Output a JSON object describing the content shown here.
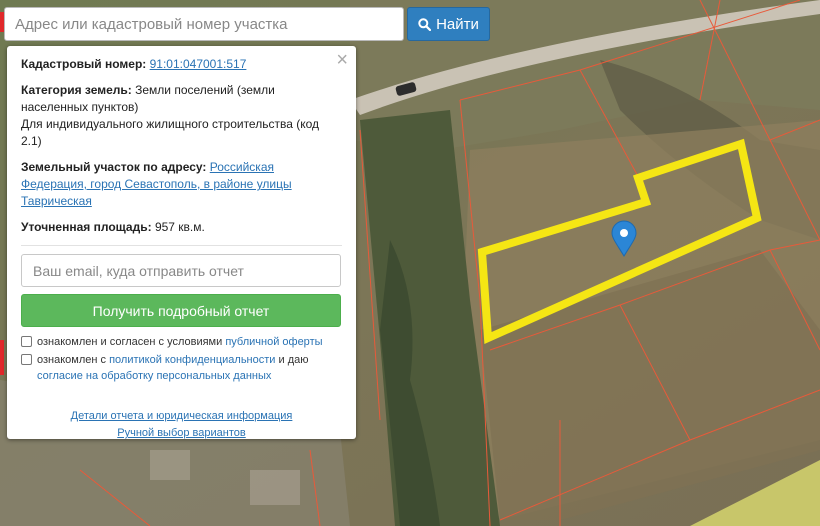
{
  "search": {
    "placeholder": "Адрес или кадастровый номер участка",
    "button_label": "Найти",
    "button_icon": "search-icon"
  },
  "panel": {
    "close_glyph": "×",
    "cadastral_label": "Кадастровый номер:",
    "cadastral_number": "91:01:047001:517",
    "category_label": "Категория земель:",
    "category_value": "Земли поселений (земли населенных пунктов)",
    "usage_text": "Для индивидуального жилищного строительства (код 2.1)",
    "address_label": "Земельный участок по адресу:",
    "address_value": "Российская Федерация, город Севастополь, в районе улицы Таврическая",
    "area_label": "Уточненная площадь:",
    "area_value": "957 кв.м.",
    "email_placeholder": "Ваш email, куда отправить отчет",
    "report_button": "Получить подробный отчет",
    "consent1_prefix": "ознакомлен и согласен с условиями",
    "consent1_link": "публичной оферты",
    "consent2_prefix": "ознакомлен с",
    "consent2_link1": "политикой конфиденциальности",
    "consent2_middle": "и даю",
    "consent2_link2": "согласие на обработку персональных данных",
    "link_details": "Детали отчета и юридическая информация",
    "link_manual": "Ручной выбор вариантов"
  },
  "map": {
    "highlight_color": "#f5e614",
    "parcel_line_color": "#e85a3a",
    "marker_color": "#2b86d6",
    "marker_icon": "map-pin-icon"
  }
}
